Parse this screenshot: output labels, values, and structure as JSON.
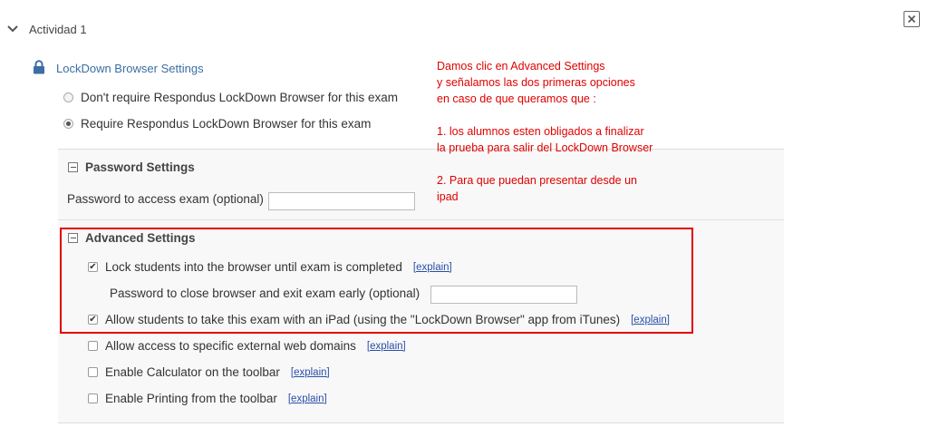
{
  "header": {
    "title": "Actividad 1"
  },
  "lockdown": {
    "title": "LockDown Browser Settings",
    "options": [
      {
        "label": "Don't require Respondus LockDown Browser for this exam",
        "selected": false
      },
      {
        "label": "Require Respondus LockDown Browser for this exam",
        "selected": true
      }
    ]
  },
  "password_settings": {
    "title": "Password Settings",
    "field_label": "Password to access exam (optional)",
    "field_value": ""
  },
  "advanced_settings": {
    "title": "Advanced Settings",
    "explain_label": "[explain]",
    "lock_students": {
      "label": "Lock students into the browser until exam is completed",
      "checked": true
    },
    "close_password": {
      "label": "Password to close browser and exit exam early (optional)",
      "value": ""
    },
    "ipad": {
      "label": "Allow students to take this exam with an iPad (using the \"LockDown Browser\" app from iTunes)",
      "checked": true
    },
    "external_domains": {
      "label": "Allow access to specific external web domains",
      "checked": false
    },
    "calculator": {
      "label": "Enable Calculator on the toolbar",
      "checked": false
    },
    "printing": {
      "label": "Enable Printing from the toolbar",
      "checked": false
    }
  },
  "annotation": {
    "text": "Damos clic en Advanced Settings\ny señalamos las dos primeras opciones\nen caso de que queramos que :\n\n1. los alumnos esten obligados a finalizar\nla prueba para salir del LockDown Browser\n\n2. Para que puedan presentar desde un\nipad",
    "color": "#e00000"
  },
  "colors": {
    "link": "#3a6ea5",
    "explain_link": "#2a4fa8",
    "highlight": "#e00000"
  }
}
